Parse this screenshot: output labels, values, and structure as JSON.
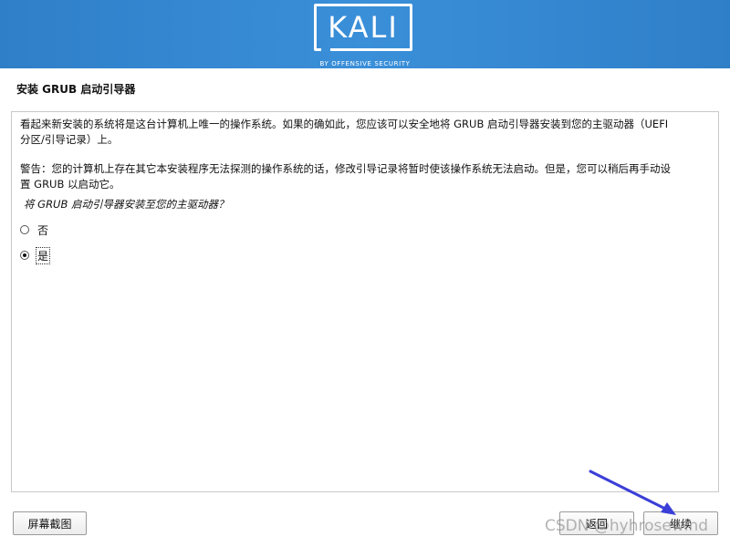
{
  "header": {
    "logo_text": "KALI",
    "logo_subtitle": "BY OFFENSIVE SECURITY",
    "banner_color": "#3a8fd9"
  },
  "page_title": "安装 GRUB 启动引导器",
  "description": {
    "paragraph1_line1": "看起来新安装的系统将是这台计算机上唯一的操作系统。如果的确如此，您应该可以安全地将 GRUB 启动引导器安装到您的主驱动器（UEFI",
    "paragraph1_line2": "分区/引导记录）上。",
    "paragraph2_line1": "警告：您的计算机上存在其它本安装程序无法探测的操作系统的话，修改引导记录将暂时使该操作系统无法启动。但是，您可以稍后再手动设",
    "paragraph2_line2": "置 GRUB 以启动它。"
  },
  "question": "将 GRUB 启动引导器安装至您的主驱动器？",
  "options": [
    {
      "label": "否",
      "selected": false
    },
    {
      "label": "是",
      "selected": true
    }
  ],
  "buttons": {
    "screenshot": "屏幕截图",
    "back": "返回",
    "continue": "继续"
  },
  "annotation": {
    "arrow_color": "#3b3fd8"
  },
  "watermark": "CSDN @hyhrosewind"
}
